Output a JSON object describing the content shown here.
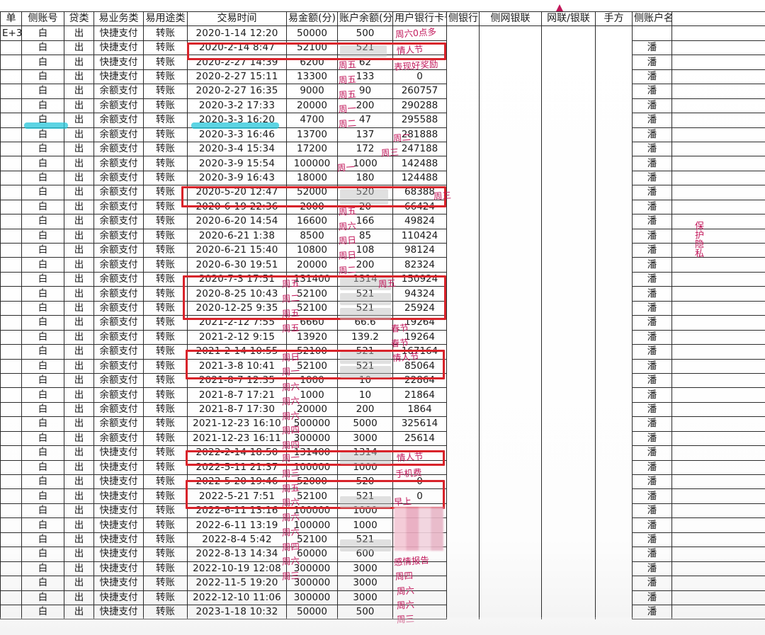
{
  "headers": [
    "单",
    "侧账号",
    "贷类",
    "易业务类",
    "易用途类",
    "交易时间",
    "易金额(分)",
    "账户余额(分",
    "用户银行卡号",
    "侧银行",
    "侧网银联",
    "网联/银联",
    "手方",
    "侧账户名"
  ],
  "first_col_row0": "E+3",
  "rows": [
    {
      "a": "白",
      "b": "出",
      "t": "快捷支付",
      "u": "转账",
      "time": "2020-1-14 12:20",
      "amount": "50000",
      "yuan": "500",
      "bal": "",
      "name": ""
    },
    {
      "a": "白",
      "b": "出",
      "t": "快捷支付",
      "u": "转账",
      "time": "2020-2-14 8:47",
      "amount": "52100",
      "yuan": "521",
      "bal": "",
      "name": "潘"
    },
    {
      "a": "白",
      "b": "出",
      "t": "快捷支付",
      "u": "转账",
      "time": "2020-2-27 14:39",
      "amount": "6200",
      "yuan": "62",
      "bal": "",
      "name": "潘"
    },
    {
      "a": "白",
      "b": "出",
      "t": "快捷支付",
      "u": "转账",
      "time": "2020-2-27 15:11",
      "amount": "13300",
      "yuan": "133",
      "bal": "0",
      "name": "潘"
    },
    {
      "a": "白",
      "b": "出",
      "t": "余额支付",
      "u": "转账",
      "time": "2020-2-27 16:35",
      "amount": "9000",
      "yuan": "90",
      "bal": "260757",
      "name": "潘"
    },
    {
      "a": "白",
      "b": "出",
      "t": "余额支付",
      "u": "转账",
      "time": "2020-3-2 17:33",
      "amount": "20000",
      "yuan": "200",
      "bal": "290288",
      "name": "潘"
    },
    {
      "a": "白",
      "b": "出",
      "t": "余额支付",
      "u": "转账",
      "time": "2020-3-3 16:20",
      "amount": "4700",
      "yuan": "47",
      "bal": "295588",
      "name": "潘"
    },
    {
      "a": "白",
      "b": "出",
      "t": "余额支付",
      "u": "转账",
      "time": "2020-3-3 16:46",
      "amount": "13700",
      "yuan": "137",
      "bal": "281888",
      "name": "潘"
    },
    {
      "a": "白",
      "b": "出",
      "t": "余额支付",
      "u": "转账",
      "time": "2020-3-4 15:34",
      "amount": "17200",
      "yuan": "172",
      "bal": "247188",
      "name": "潘"
    },
    {
      "a": "白",
      "b": "出",
      "t": "余额支付",
      "u": "转账",
      "time": "2020-3-9 15:54",
      "amount": "100000",
      "yuan": "1000",
      "bal": "142488",
      "name": "潘"
    },
    {
      "a": "白",
      "b": "出",
      "t": "余额支付",
      "u": "转账",
      "time": "2020-3-9 16:43",
      "amount": "18000",
      "yuan": "180",
      "bal": "124488",
      "name": "潘"
    },
    {
      "a": "白",
      "b": "出",
      "t": "余额支付",
      "u": "转账",
      "time": "2020-5-20 12:47",
      "amount": "52000",
      "yuan": "520",
      "bal": "68388",
      "name": "潘"
    },
    {
      "a": "白",
      "b": "出",
      "t": "余额支付",
      "u": "转账",
      "time": "2020-6-19 22:36",
      "amount": "2000",
      "yuan": "20",
      "bal": "66424",
      "name": "潘"
    },
    {
      "a": "白",
      "b": "出",
      "t": "余额支付",
      "u": "转账",
      "time": "2020-6-20 14:54",
      "amount": "16600",
      "yuan": "166",
      "bal": "49824",
      "name": "潘"
    },
    {
      "a": "白",
      "b": "出",
      "t": "余额支付",
      "u": "转账",
      "time": "2020-6-21 1:38",
      "amount": "8500",
      "yuan": "85",
      "bal": "110424",
      "name": "潘"
    },
    {
      "a": "白",
      "b": "出",
      "t": "余额支付",
      "u": "转账",
      "time": "2020-6-21 15:40",
      "amount": "10800",
      "yuan": "108",
      "bal": "98124",
      "name": "潘"
    },
    {
      "a": "白",
      "b": "出",
      "t": "余额支付",
      "u": "转账",
      "time": "2020-6-30 19:51",
      "amount": "20000",
      "yuan": "200",
      "bal": "82324",
      "name": "潘"
    },
    {
      "a": "白",
      "b": "出",
      "t": "余额支付",
      "u": "转账",
      "time": "2020-7-3 17:51",
      "amount": "131400",
      "yuan": "1314",
      "bal": "150924",
      "name": "潘"
    },
    {
      "a": "白",
      "b": "出",
      "t": "余额支付",
      "u": "转账",
      "time": "2020-8-25 10:43",
      "amount": "52100",
      "yuan": "521",
      "bal": "94324",
      "name": "潘"
    },
    {
      "a": "白",
      "b": "出",
      "t": "余额支付",
      "u": "转账",
      "time": "2020-12-25 9:35",
      "amount": "52100",
      "yuan": "521",
      "bal": "25924",
      "name": "潘"
    },
    {
      "a": "白",
      "b": "出",
      "t": "余额支付",
      "u": "转账",
      "time": "2021-2-12 7:55",
      "amount": "6660",
      "yuan": "66.6",
      "bal": "19264",
      "name": "潘"
    },
    {
      "a": "白",
      "b": "出",
      "t": "余额支付",
      "u": "转账",
      "time": "2021-2-12 9:15",
      "amount": "13920",
      "yuan": "139.2",
      "bal": "19264",
      "name": "潘"
    },
    {
      "a": "白",
      "b": "出",
      "t": "余额支付",
      "u": "转账",
      "time": "2021-2-14 10:55",
      "amount": "52100",
      "yuan": "521",
      "bal": "167164",
      "name": "潘"
    },
    {
      "a": "白",
      "b": "出",
      "t": "余额支付",
      "u": "转账",
      "time": "2021-3-8 10:41",
      "amount": "52100",
      "yuan": "521",
      "bal": "85064",
      "name": "潘"
    },
    {
      "a": "白",
      "b": "出",
      "t": "余额支付",
      "u": "转账",
      "time": "2021-8-7 12:35",
      "amount": "1000",
      "yuan": "10",
      "bal": "22864",
      "name": "潘"
    },
    {
      "a": "白",
      "b": "出",
      "t": "余额支付",
      "u": "转账",
      "time": "2021-8-7 17:21",
      "amount": "1000",
      "yuan": "10",
      "bal": "21864",
      "name": "潘"
    },
    {
      "a": "白",
      "b": "出",
      "t": "余额支付",
      "u": "转账",
      "time": "2021-8-7 17:30",
      "amount": "20000",
      "yuan": "200",
      "bal": "1864",
      "name": "潘"
    },
    {
      "a": "白",
      "b": "出",
      "t": "余额支付",
      "u": "转账",
      "time": "2021-12-23 16:10",
      "amount": "500000",
      "yuan": "5000",
      "bal": "325614",
      "name": "潘"
    },
    {
      "a": "白",
      "b": "出",
      "t": "余额支付",
      "u": "转账",
      "time": "2021-12-23 16:11",
      "amount": "300000",
      "yuan": "3000",
      "bal": "25614",
      "name": "潘"
    },
    {
      "a": "白",
      "b": "出",
      "t": "快捷支付",
      "u": "转账",
      "time": "2022-2-14 18:50",
      "amount": "131400",
      "yuan": "1314",
      "bal": "",
      "name": "潘"
    },
    {
      "a": "白",
      "b": "出",
      "t": "快捷支付",
      "u": "转账",
      "time": "2022-5-11 21:37",
      "amount": "100000",
      "yuan": "1000",
      "bal": "",
      "name": "潘"
    },
    {
      "a": "白",
      "b": "出",
      "t": "快捷支付",
      "u": "转账",
      "time": "2022-5-20 19:46",
      "amount": "52000",
      "yuan": "520",
      "bal": "0",
      "name": "潘"
    },
    {
      "a": "白",
      "b": "出",
      "t": "快捷支付",
      "u": "转账",
      "time": "2022-5-21 7:51",
      "amount": "52100",
      "yuan": "521",
      "bal": "0",
      "name": "潘"
    },
    {
      "a": "白",
      "b": "出",
      "t": "快捷支付",
      "u": "转账",
      "time": "2022-6-11 13:16",
      "amount": "100000",
      "yuan": "1000",
      "bal": "",
      "name": "潘"
    },
    {
      "a": "白",
      "b": "出",
      "t": "快捷支付",
      "u": "转账",
      "time": "2022-6-11 13:19",
      "amount": "100000",
      "yuan": "1000",
      "bal": "",
      "name": "潘"
    },
    {
      "a": "白",
      "b": "出",
      "t": "快捷支付",
      "u": "转账",
      "time": "2022-8-4 5:42",
      "amount": "52100",
      "yuan": "521",
      "bal": "",
      "name": "潘"
    },
    {
      "a": "白",
      "b": "出",
      "t": "快捷支付",
      "u": "转账",
      "time": "2022-8-13 14:34",
      "amount": "60000",
      "yuan": "600",
      "bal": "",
      "name": "潘"
    },
    {
      "a": "白",
      "b": "出",
      "t": "快捷支付",
      "u": "转账",
      "time": "2022-10-19 12:08",
      "amount": "300000",
      "yuan": "3000",
      "bal": "",
      "name": "潘"
    },
    {
      "a": "白",
      "b": "出",
      "t": "快捷支付",
      "u": "转账",
      "time": "2022-11-5 19:20",
      "amount": "300000",
      "yuan": "3000",
      "bal": "",
      "name": "潘"
    },
    {
      "a": "白",
      "b": "出",
      "t": "快捷支付",
      "u": "转账",
      "time": "2022-12-10 11:06",
      "amount": "300000",
      "yuan": "3000",
      "bal": "",
      "name": "潘"
    },
    {
      "a": "白",
      "b": "出",
      "t": "快捷支付",
      "u": "转账",
      "time": "2023-1-18 10:32",
      "amount": "50000",
      "yuan": "500",
      "bal": "",
      "name": "潘"
    }
  ],
  "notes": {
    "r0": "周六0点多",
    "r1": "情人节",
    "r2": "周五",
    "r2b": "表现好奖励",
    "r3": "周五",
    "r4": "周五",
    "r5": "周一",
    "r6": "周二",
    "r7": "周二",
    "r8": "周三",
    "r9": "周一",
    "r11": "周三",
    "r12": "周五",
    "r13": "周六",
    "r14": "周日",
    "r15": "周日",
    "r16": "周二",
    "r17a": "周五",
    "r17b": "周五",
    "r18": "周二",
    "r19": "周五",
    "r20": "周五",
    "r20b": "春节",
    "r21": "春节",
    "r22a": "周日",
    "r22b": "情人节",
    "r23": "周一",
    "r24": "周六",
    "r25": "周六",
    "r26": "周六",
    "r27": "周四",
    "r28": "周四",
    "r29a": "周一",
    "r29b": "情人节",
    "r30a": "周三",
    "r30b": "手机费",
    "r31": "周五",
    "r32a": "周六",
    "r32b": "早上",
    "r33": "周六",
    "r34": "周六",
    "r35": "周四",
    "r36a": "周六",
    "r36b": "感情报告",
    "r37a": "周三",
    "r37b": "周四",
    "r38": "周六",
    "r39": "周六",
    "r40": "周三",
    "right_margin": "保护隐私"
  }
}
